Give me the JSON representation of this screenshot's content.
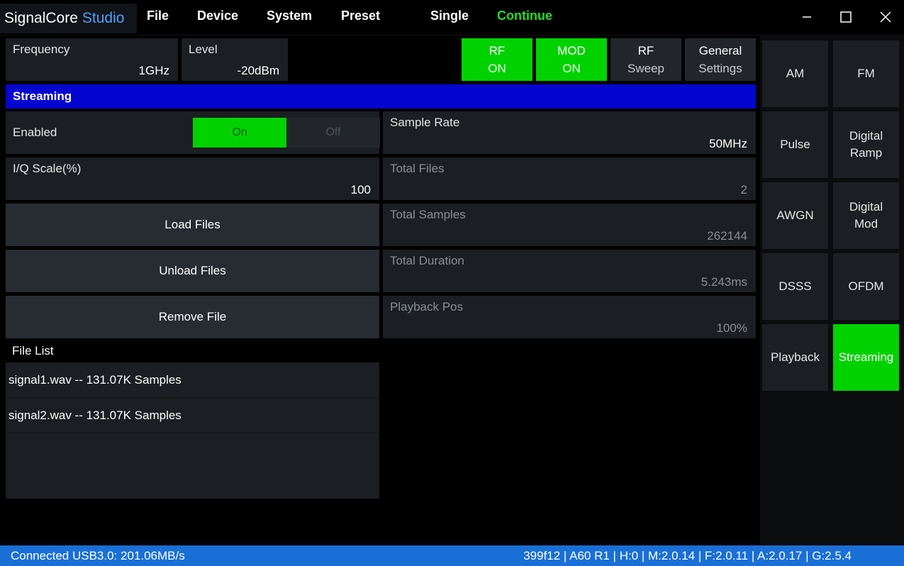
{
  "app": {
    "brand_primary": "SignalCore",
    "brand_secondary": "Studio"
  },
  "menu": {
    "file": "File",
    "device": "Device",
    "system": "System",
    "preset": "Preset",
    "single": "Single",
    "continue": "Continue"
  },
  "window_controls": {
    "minimize_icon": "minimize-icon",
    "maximize_icon": "maximize-icon",
    "close_icon": "close-icon"
  },
  "colors": {
    "accent_green": "#00d200",
    "section_blue": "#0505d0",
    "status_blue": "#1a6fd6",
    "studio_blue": "#4aa3ff"
  },
  "top": {
    "frequency": {
      "label": "Frequency",
      "value": "1GHz"
    },
    "level": {
      "label": "Level",
      "value": "-20dBm"
    },
    "buttons": [
      {
        "line1": "RF",
        "line2": "ON",
        "active": true
      },
      {
        "line1": "MOD",
        "line2": "ON",
        "active": true
      },
      {
        "line1": "RF",
        "line2": "Sweep",
        "active": false
      },
      {
        "line1": "General",
        "line2": "Settings",
        "active": false
      }
    ]
  },
  "section": {
    "title": "Streaming"
  },
  "streaming": {
    "enabled": {
      "label": "Enabled",
      "on": "On",
      "off": "Off",
      "state": "On"
    },
    "iq_scale": {
      "label": "I/Q Scale(%)",
      "value": "100"
    },
    "actions": {
      "load": "Load Files",
      "unload": "Unload Files",
      "remove": "Remove File"
    },
    "sample_rate": {
      "label": "Sample Rate",
      "value": "50MHz"
    },
    "total_files": {
      "label": "Total Files",
      "value": "2"
    },
    "total_samples": {
      "label": "Total Samples",
      "value": "262144"
    },
    "total_duration": {
      "label": "Total Duration",
      "value": "5.243ms"
    },
    "playback_pos": {
      "label": "Playback Pos",
      "value": "100%"
    },
    "file_list": {
      "label": "File List",
      "items": [
        "signal1.wav -- 131.07K Samples",
        "signal2.wav -- 131.07K Samples"
      ]
    }
  },
  "modes": [
    "AM",
    "FM",
    "Pulse",
    "Digital Ramp",
    "AWGN",
    "Digital Mod",
    "DSSS",
    "OFDM",
    "Playback",
    "Streaming"
  ],
  "active_mode": "Streaming",
  "status": {
    "left": "Connected USB3.0: 201.06MB/s",
    "right": "399f12 | A60 R1 | H:0 | M:2.0.14 | F:2.0.11 | A:2.0.17 | G:2.5.4"
  }
}
